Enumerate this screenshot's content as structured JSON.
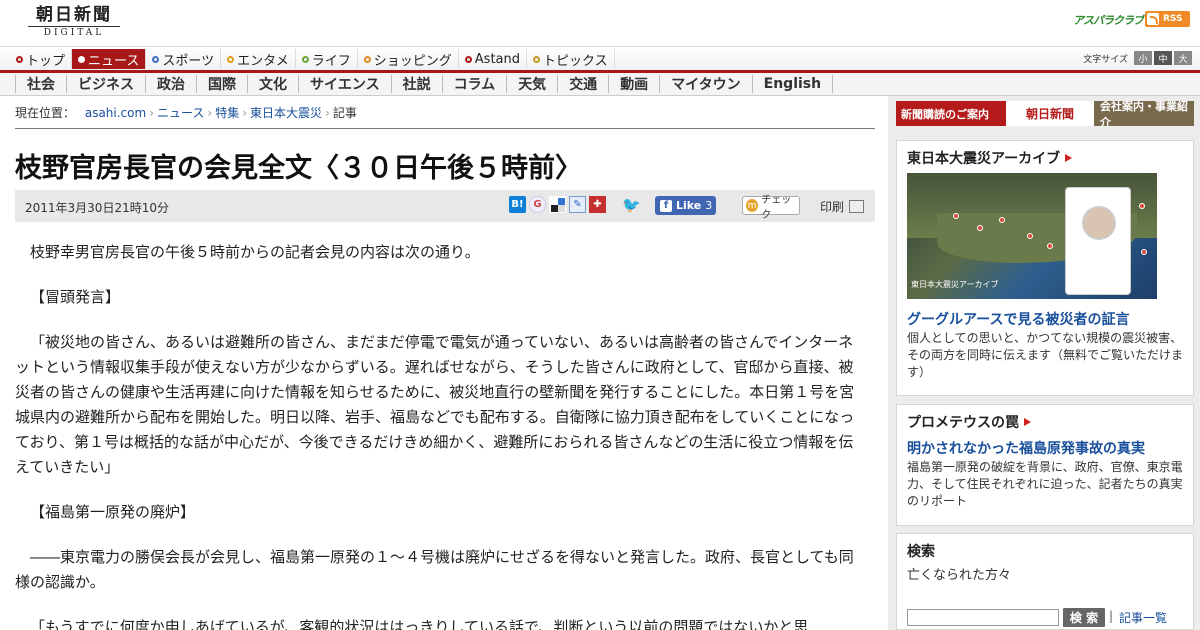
{
  "header": {
    "logo_jp": "朝日新聞",
    "logo_en": "DIGITAL",
    "asupara": "アスパラクラブ",
    "rss": "RSS"
  },
  "mainnav": {
    "items": [
      {
        "label": "トップ",
        "color": "#a71818"
      },
      {
        "label": "ニュース",
        "color": "#a71818"
      },
      {
        "label": "スポーツ",
        "color": "#3a6fc4"
      },
      {
        "label": "エンタメ",
        "color": "#e0a020"
      },
      {
        "label": "ライフ",
        "color": "#6aa532"
      },
      {
        "label": "ショッピング",
        "color": "#e08a20"
      },
      {
        "label": "Astand",
        "color": "#a71818"
      },
      {
        "label": "トピックス",
        "color": "#c49a20"
      }
    ],
    "fontsize_label": "文字サイズ",
    "fontsize_small": "小",
    "fontsize_medium": "中",
    "fontsize_large": "大"
  },
  "subnav": {
    "items": [
      "社会",
      "ビジネス",
      "政治",
      "国際",
      "文化",
      "サイエンス",
      "社説",
      "コラム",
      "天気",
      "交通",
      "動画",
      "マイタウン",
      "English"
    ]
  },
  "breadcrumb": {
    "prefix": "現在位置：",
    "items": [
      "asahi.com",
      "ニュース",
      "特集",
      "東日本大震災",
      "記事"
    ]
  },
  "article": {
    "title": "枝野官房長官の会見全文〈３０日午後５時前〉",
    "date": "2011年3月30日21時10分",
    "fb_like": "Like",
    "fb_count": "3",
    "check_label": "チェック",
    "print_label": "印刷",
    "paragraphs": [
      "枝野幸男官房長官の午後５時前からの記者会見の内容は次の通り。",
      "【冒頭発言】",
      "「被災地の皆さん、あるいは避難所の皆さん、まだまだ停電で電気が通っていない、あるいは高齢者の皆さんでインターネットという情報収集手段が使えない方が少なからずいる。遅ればせながら、そうした皆さんに政府として、官邸から直接、被災者の皆さんの健康や生活再建に向けた情報を知らせるために、被災地直行の壁新聞を発行することにした。本日第１号を宮城県内の避難所から配布を開始した。明日以降、岩手、福島などでも配布する。自衛隊に協力頂き配布をしていくことになっており、第１号は概括的な話が中心だが、今後できるだけきめ細かく、避難所におられる皆さんなどの生活に役立つ情報を伝えていきたい」",
      "【福島第一原発の廃炉】",
      "――東京電力の勝俣会長が会見し、福島第一原発の１～４号機は廃炉にせざるを得ないと発言した。政府、長官としても同様の認識か。",
      "「もうすでに何度か申しあげているが、客観的状況ははっきりしている話で、判断という以前の問題ではないかと思"
    ]
  },
  "sidebar": {
    "banner_left": "新聞購読のご案内",
    "banner_mid": "朝日新聞",
    "banner_right": "会社案内・事業紹介",
    "archive": {
      "heading": "東日本大震災アーカイブ",
      "map_caption": "東日本大震災アーカイブ",
      "link": "グーグルアースで見る被災者の証言",
      "desc": "個人としての思いと、かつてない規模の震災被害、その両方を同時に伝えます（無料でご覧いただけます）"
    },
    "prometheus": {
      "heading": "プロメテウスの罠",
      "link": "明かされなかった福島原発事故の真実",
      "desc": "福島第一原発の破綻を背景に、政府、官僚、東京電力、そして住民それぞれに迫った、記者たちの真実のリポート"
    },
    "search": {
      "heading": "検索",
      "label": "亡くなられた方々",
      "button": "検 索",
      "link": "記事一覧"
    }
  }
}
